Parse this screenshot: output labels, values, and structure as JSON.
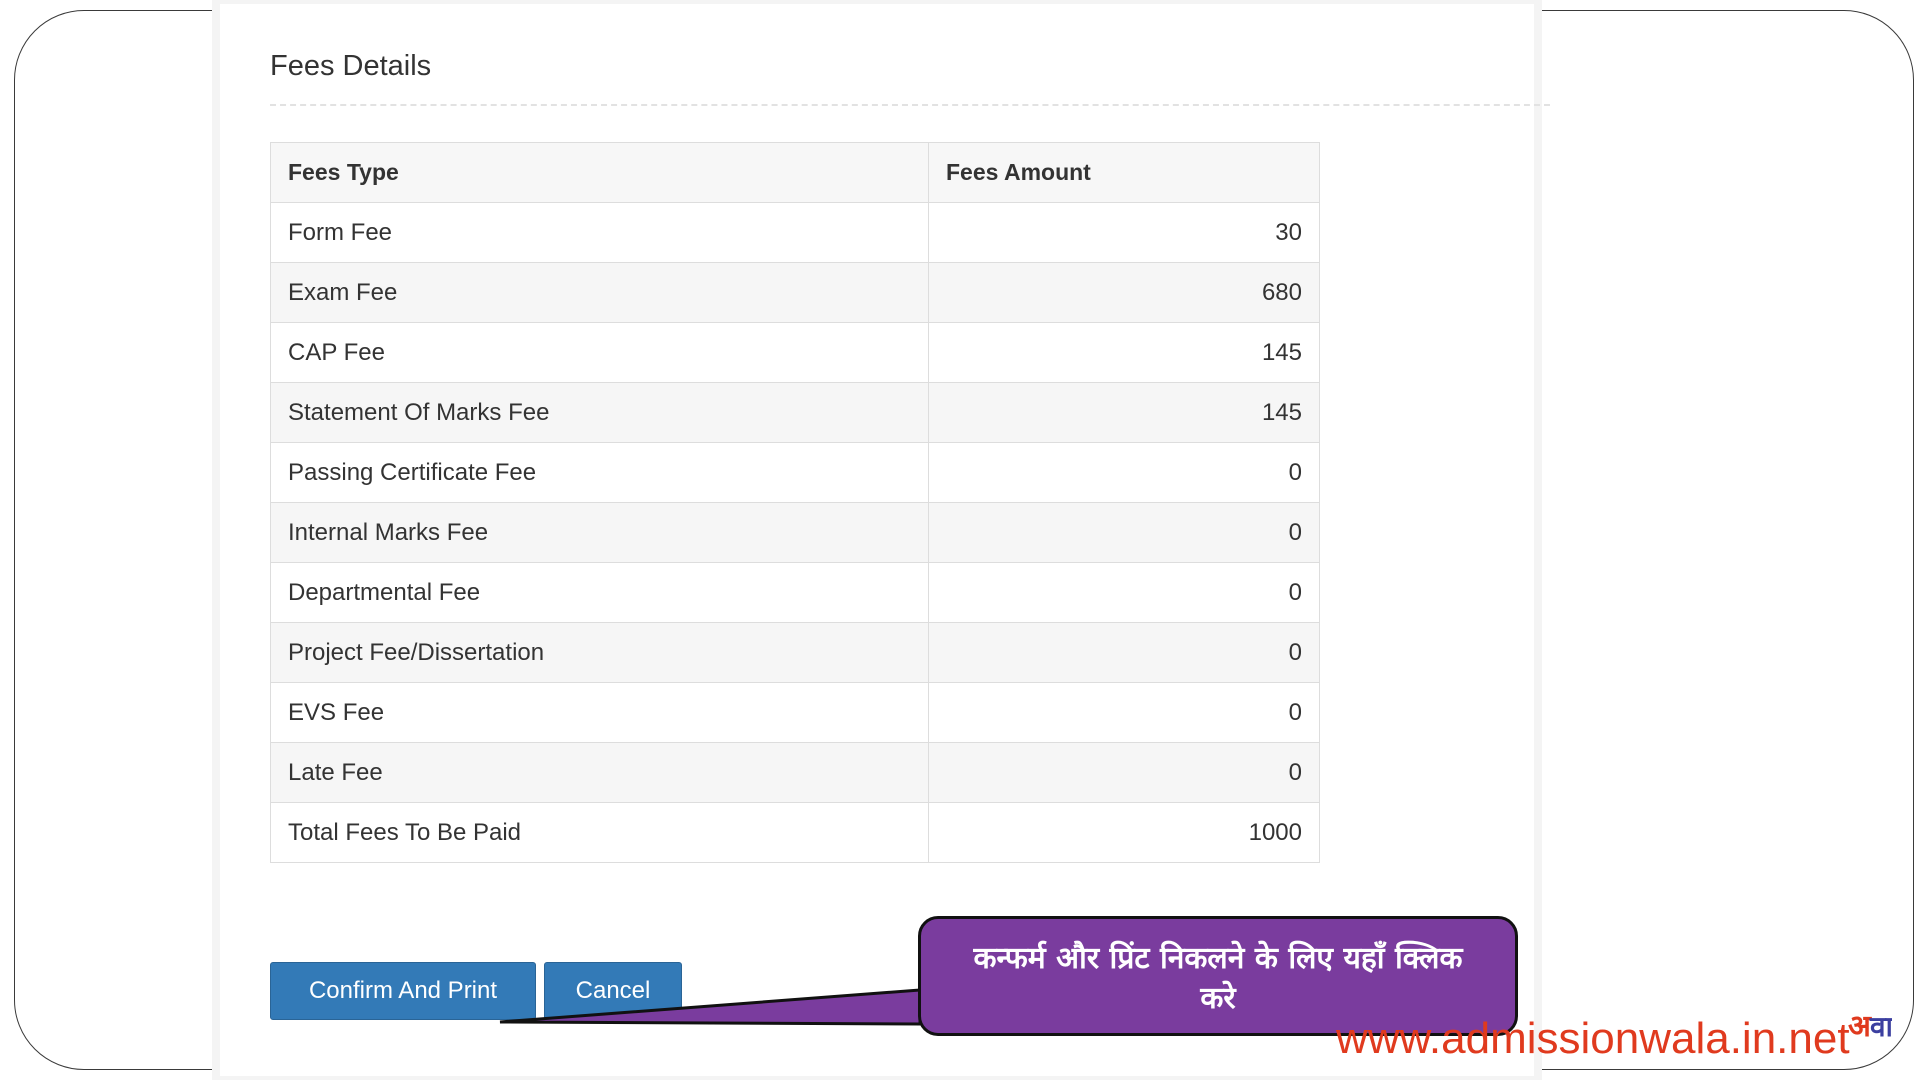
{
  "section": {
    "title": "Fees Details"
  },
  "table": {
    "headers": [
      "Fees Type",
      "Fees Amount"
    ],
    "rows": [
      {
        "type": "Form Fee",
        "amount": "30"
      },
      {
        "type": "Exam Fee",
        "amount": "680"
      },
      {
        "type": "CAP Fee",
        "amount": "145"
      },
      {
        "type": "Statement Of Marks Fee",
        "amount": "145"
      },
      {
        "type": "Passing Certificate Fee",
        "amount": "0"
      },
      {
        "type": "Internal Marks Fee",
        "amount": "0"
      },
      {
        "type": "Departmental Fee",
        "amount": "0"
      },
      {
        "type": "Project Fee/Dissertation",
        "amount": "0"
      },
      {
        "type": "EVS Fee",
        "amount": "0"
      },
      {
        "type": "Late Fee",
        "amount": "0"
      },
      {
        "type": "Total Fees To Be Paid",
        "amount": "1000"
      }
    ]
  },
  "buttons": {
    "confirm": "Confirm And Print",
    "cancel": "Cancel"
  },
  "callout": {
    "text": "कन्फर्म और प्रिंट निकलने के लिए यहाँ क्लिक करे"
  },
  "watermark": {
    "text": "www.admissionwala.in.net",
    "logo_icon": "admissionwala-logo-icon"
  },
  "colors": {
    "primary_button": "#337ab7",
    "callout_fill": "#7a3c9e",
    "watermark": "#e03a1e"
  }
}
